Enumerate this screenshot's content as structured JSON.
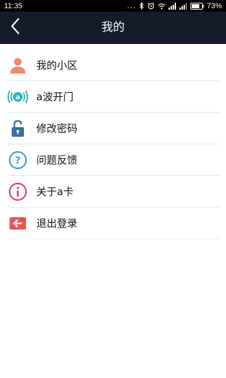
{
  "status_bar": {
    "time": "11:35",
    "dots": "...",
    "battery_percent": "73%"
  },
  "header": {
    "title": "我的",
    "back_icon": "chevron-left-icon"
  },
  "menu": {
    "items": [
      {
        "label": "我的小区",
        "icon": "person-icon",
        "color": "#f08a6a"
      },
      {
        "label": "a波开门",
        "icon": "a-wave-icon",
        "color": "#2ab7b6"
      },
      {
        "label": "修改密码",
        "icon": "lock-icon",
        "color": "#3c6fa6"
      },
      {
        "label": "问题反馈",
        "icon": "question-icon",
        "color": "#3aa0e0"
      },
      {
        "label": "关于a卡",
        "icon": "info-icon",
        "color": "#e43a96"
      },
      {
        "label": "退出登录",
        "icon": "logout-icon",
        "color": "#ef5350"
      }
    ]
  }
}
